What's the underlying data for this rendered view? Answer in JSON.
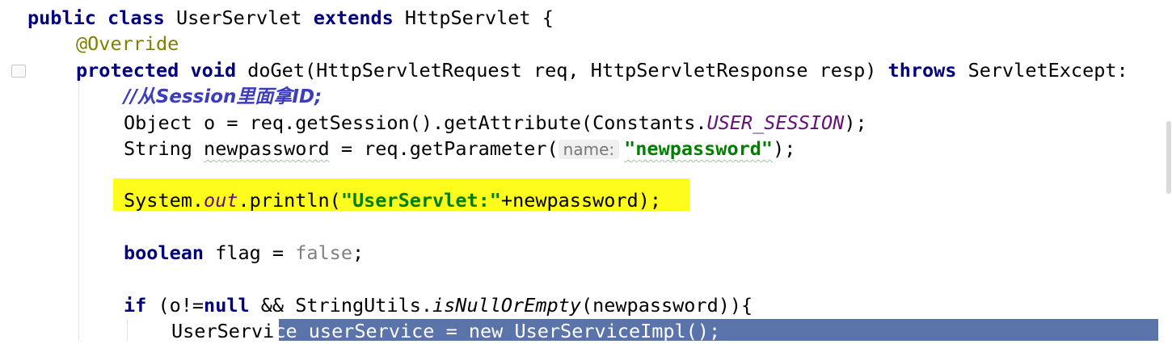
{
  "editor": {
    "lines": {
      "l1": {
        "kw1": "public",
        "kw2": "class",
        "name": " UserServlet ",
        "kw3": "extends",
        "rest": " HttpServlet {"
      },
      "l2": {
        "annotation": "@Override"
      },
      "l3": {
        "kw1": "protected",
        "kw2": "void",
        "rest": " doGet(HttpServletRequest req, HttpServletResponse resp) ",
        "kw3": "throws",
        "tail": " ServletExcept:"
      },
      "l4": {
        "comment": "//从Session里面拿ID;"
      },
      "l5": {
        "pre": "Object o = req.getSession().getAttribute(Constants.",
        "const": "USER_SESSION",
        "post": ");"
      },
      "l6": {
        "pre": "String ",
        "var": "newpassword",
        "mid": " = req.getParameter(",
        "hint": "name:",
        "str": "\"newpassword\"",
        "post": ");"
      },
      "l7": {
        "pre": "System.",
        "field": "out",
        "mid": ".println(",
        "str": "\"UserServlet:\"",
        "post": "+newpassword);"
      },
      "l8": {
        "kw": "boolean",
        "mid": " flag = ",
        "val": "false",
        "post": ";"
      },
      "l9": {
        "kw": "if",
        "pre": " (o!=",
        "kw2": "null",
        "mid": " && StringUtils.",
        "call": "isNullOrEmpty",
        "post": "(newpassword)){"
      },
      "l10": {
        "pre": "UserServi",
        "selected": "ce userService = new UserServiceImpl();"
      }
    }
  },
  "colors": {
    "keyword": "#000080",
    "annotation": "#808000",
    "comment": "#3c3cbe",
    "string": "#008000",
    "constant": "#660e7a",
    "line_highlight": "#fdfc1c",
    "selection": "#5a73a8"
  },
  "icons": {
    "fold": "fold-marker-icon"
  }
}
